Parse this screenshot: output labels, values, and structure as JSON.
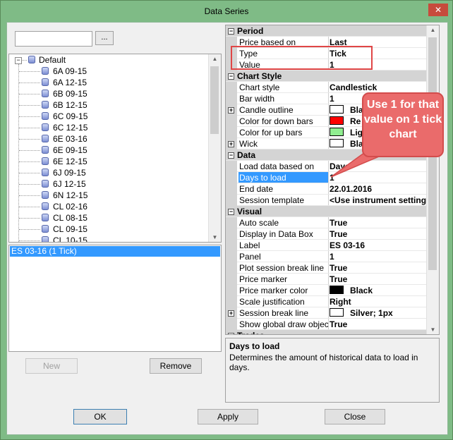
{
  "window": {
    "title": "Data Series"
  },
  "search": {
    "value": "",
    "browse_label": "..."
  },
  "tree": {
    "root_label": "Default",
    "items": [
      "6A 09-15",
      "6A 12-15",
      "6B 09-15",
      "6B 12-15",
      "6C 09-15",
      "6C 12-15",
      "6E 03-16",
      "6E 09-15",
      "6E 12-15",
      "6J 09-15",
      "6J 12-15",
      "6N 12-15",
      "CL 02-16",
      "CL 08-15",
      "CL 09-15",
      "CL 10-15"
    ]
  },
  "series": {
    "selected": "ES 03-16 (1 Tick)"
  },
  "left_buttons": {
    "new": "New",
    "remove": "Remove"
  },
  "properties": {
    "period": {
      "header": "Period",
      "rows": [
        {
          "name": "Price based on",
          "value": "Last"
        },
        {
          "name": "Type",
          "value": "Tick"
        },
        {
          "name": "Value",
          "value": "1"
        }
      ]
    },
    "chart_style": {
      "header": "Chart Style",
      "rows": [
        {
          "name": "Chart style",
          "value": "Candlestick"
        },
        {
          "name": "Bar width",
          "value": "1"
        },
        {
          "name": "Candle outline",
          "value": "Bla",
          "swatch": "#ffffff"
        },
        {
          "name": "Color for down bars",
          "value": "Re",
          "swatch": "#ff0000"
        },
        {
          "name": "Color for up bars",
          "value": "Lig",
          "swatch": "#90ee90"
        },
        {
          "name": "Wick",
          "value": "Bla",
          "swatch": "#ffffff"
        }
      ]
    },
    "data": {
      "header": "Data",
      "rows": [
        {
          "name": "Load data based on",
          "value": "Days"
        },
        {
          "name": "Days to load",
          "value": "1"
        },
        {
          "name": "End date",
          "value": "22.01.2016"
        },
        {
          "name": "Session template",
          "value": "<Use instrument settings>"
        }
      ]
    },
    "visual": {
      "header": "Visual",
      "rows": [
        {
          "name": "Auto scale",
          "value": "True"
        },
        {
          "name": "Display in Data Box",
          "value": "True"
        },
        {
          "name": "Label",
          "value": "ES 03-16"
        },
        {
          "name": "Panel",
          "value": "1"
        },
        {
          "name": "Plot session break line",
          "value": "True"
        },
        {
          "name": "Price marker",
          "value": "True"
        },
        {
          "name": "Price marker color",
          "value": "Black",
          "swatch": "#000000"
        },
        {
          "name": "Scale justification",
          "value": "Right"
        },
        {
          "name": "Session break line",
          "value": "Silver;  1px",
          "swatch": "#ffffff"
        },
        {
          "name": "Show global draw objects",
          "value": "True"
        }
      ]
    },
    "next_header": "Trades"
  },
  "description": {
    "title": "Days to load",
    "text": "Determines the amount of historical data to load in days."
  },
  "callout": {
    "text": "Use 1 for that value on 1 tick chart"
  },
  "bottom_buttons": {
    "ok": "OK",
    "apply": "Apply",
    "close": "Close"
  },
  "colors": {
    "titlebar": "#7fbb86",
    "close_button": "#c74b3c",
    "selection": "#3399ff",
    "callout": "#ea6b6b",
    "highlight_box": "#e04646"
  }
}
